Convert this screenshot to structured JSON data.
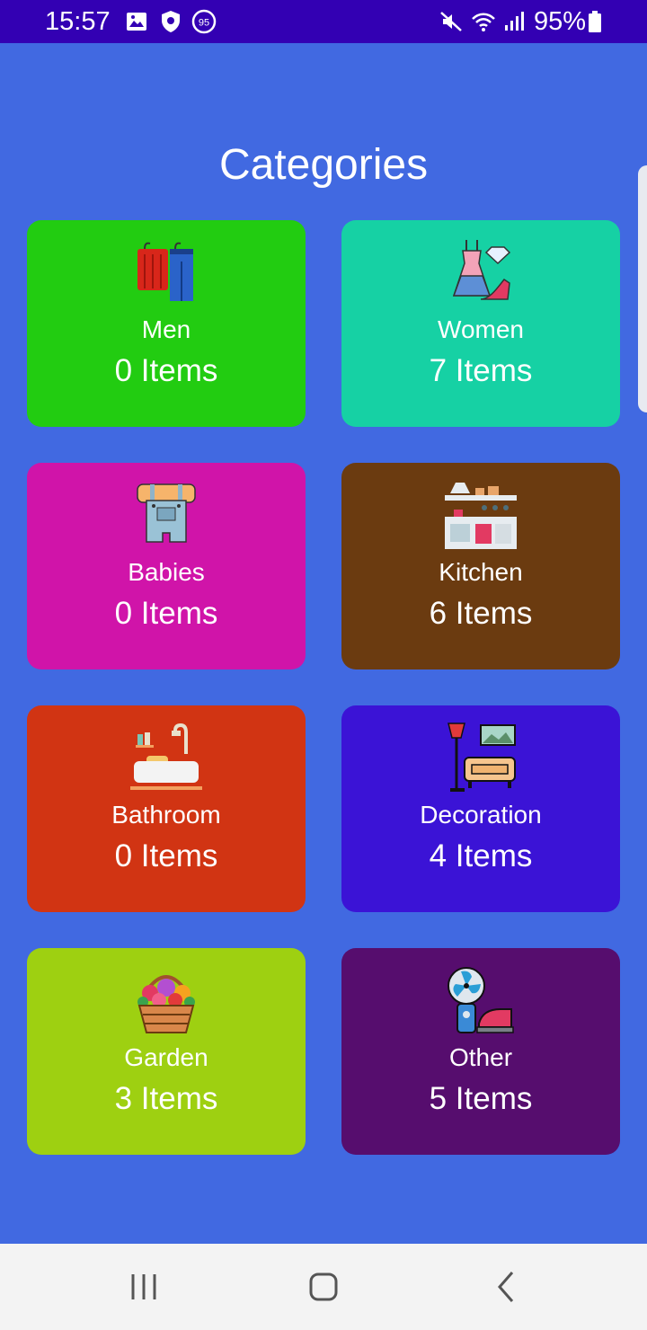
{
  "status_bar": {
    "time": "15:57",
    "battery": "95%",
    "notification_badge": "95",
    "icons": [
      "gallery-icon",
      "shield-icon",
      "notification-badge-icon",
      "mute-icon",
      "wifi-icon",
      "signal-icon",
      "battery-icon"
    ]
  },
  "page": {
    "title": "Categories"
  },
  "categories": [
    {
      "name": "Men",
      "count": "0 Items",
      "color": "#22cc11",
      "icon": "clothes-rack-icon"
    },
    {
      "name": "Women",
      "count": "7 Items",
      "color": "#16d1a4",
      "icon": "dress-icon"
    },
    {
      "name": "Babies",
      "count": "0 Items",
      "color": "#d014a9",
      "icon": "baby-overalls-icon"
    },
    {
      "name": "Kitchen",
      "count": "6 Items",
      "color": "#6b3b10",
      "icon": "kitchen-icon"
    },
    {
      "name": "Bathroom",
      "count": "0 Items",
      "color": "#d13413",
      "icon": "bathtub-icon"
    },
    {
      "name": "Decoration",
      "count": "4 Items",
      "color": "#3b13d6",
      "icon": "lamp-sofa-icon"
    },
    {
      "name": "Garden",
      "count": "3 Items",
      "color": "#9ed011",
      "icon": "flower-basket-icon"
    },
    {
      "name": "Other",
      "count": "5 Items",
      "color": "#560d6e",
      "icon": "fan-iron-icon"
    }
  ],
  "nav_bar": {
    "buttons": [
      "recents-icon",
      "home-icon",
      "back-icon"
    ]
  },
  "colors": {
    "background": "#4169e1",
    "status_bar": "#3300b3",
    "nav_bar": "#f3f3f3"
  }
}
